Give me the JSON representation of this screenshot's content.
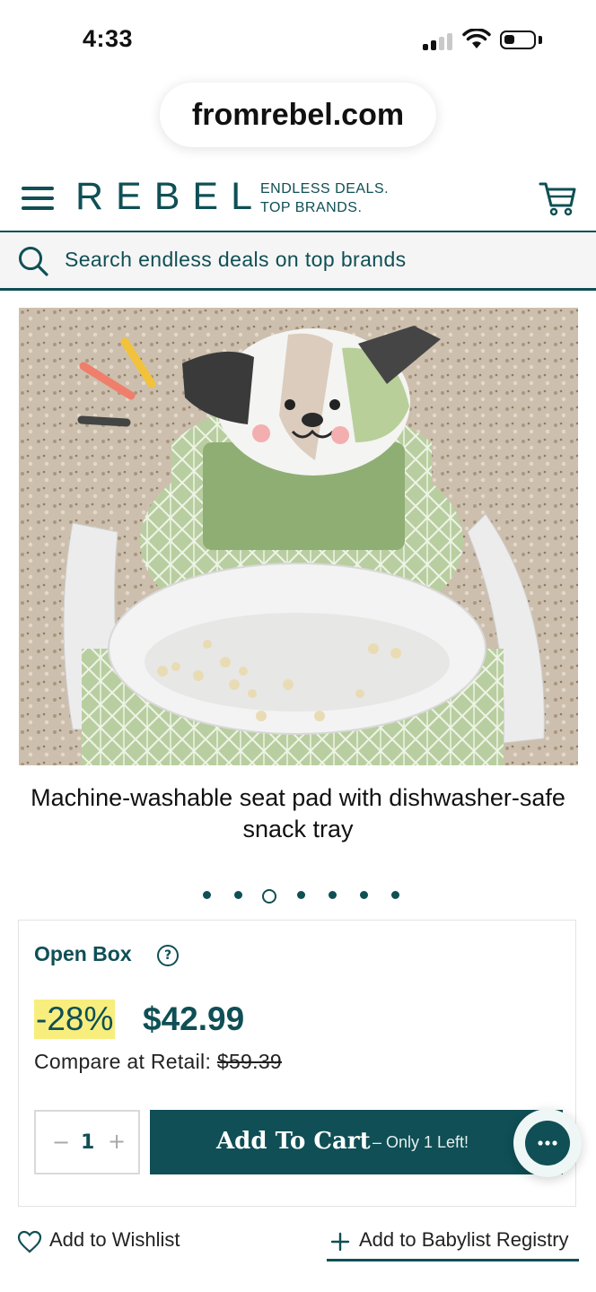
{
  "status_bar": {
    "time": "4:33"
  },
  "browser": {
    "url": "fromrebel.com"
  },
  "header": {
    "logo": "REBEL",
    "tagline_line1": "ENDLESS DEALS.",
    "tagline_line2": "TOP BRANDS.",
    "menu_icon": "hamburger-menu-icon",
    "cart_icon": "shopping-cart-icon"
  },
  "search": {
    "placeholder": "Search endless deals on top brands",
    "icon": "search-icon"
  },
  "product": {
    "image_caption": "Machine-washable seat pad with dishwasher-safe snack tray",
    "carousel": {
      "count": 7,
      "active_index": 2
    }
  },
  "purchase": {
    "condition": "Open Box",
    "help_icon": "question-circle-icon",
    "discount": "-28%",
    "price": "$42.99",
    "compare_label": "Compare at Retail:",
    "compare_price": "$59.39",
    "quantity": "1",
    "minus": "−",
    "plus": "+",
    "add_to_cart": "Add To Cart",
    "stock_note": "– Only 1 Left!"
  },
  "actions": {
    "wishlist": "Add to Wishlist",
    "registry": "Add to Babylist Registry"
  },
  "colors": {
    "brand": "#0f4f55",
    "discount_highlight": "#f7ee7e"
  }
}
